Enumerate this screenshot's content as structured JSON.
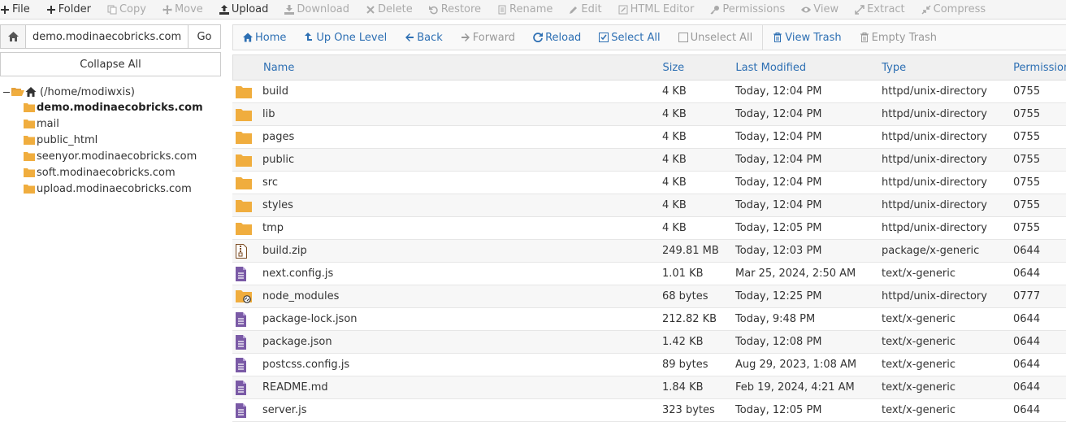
{
  "toolbar": {
    "buttons": [
      {
        "label": "File",
        "icon": "plus-icon",
        "enabled": true
      },
      {
        "label": "Folder",
        "icon": "plus-icon",
        "enabled": true
      },
      {
        "label": "Copy",
        "icon": "copy-icon",
        "enabled": false
      },
      {
        "label": "Move",
        "icon": "move-icon",
        "enabled": false
      },
      {
        "label": "Upload",
        "icon": "upload-icon",
        "enabled": true
      },
      {
        "label": "Download",
        "icon": "download-icon",
        "enabled": false
      },
      {
        "label": "Delete",
        "icon": "delete-icon",
        "enabled": false
      },
      {
        "label": "Restore",
        "icon": "restore-icon",
        "enabled": false
      },
      {
        "label": "Rename",
        "icon": "rename-icon",
        "enabled": false
      },
      {
        "label": "Edit",
        "icon": "pencil-icon",
        "enabled": false
      },
      {
        "label": "HTML Editor",
        "icon": "html-editor-icon",
        "enabled": false
      },
      {
        "label": "Permissions",
        "icon": "key-icon",
        "enabled": false
      },
      {
        "label": "View",
        "icon": "eye-icon",
        "enabled": false
      },
      {
        "label": "Extract",
        "icon": "extract-icon",
        "enabled": false
      },
      {
        "label": "Compress",
        "icon": "compress-icon",
        "enabled": false
      }
    ]
  },
  "sidebar": {
    "address_value": "demo.modinaecobricks.com",
    "go_label": "Go",
    "collapse_label": "Collapse All",
    "root_label": "(/home/modiwxis)",
    "items": [
      {
        "label": "demo.modinaecobricks.com",
        "active": true
      },
      {
        "label": "mail",
        "active": false
      },
      {
        "label": "public_html",
        "active": false
      },
      {
        "label": "seenyor.modinaecobricks.com",
        "active": false
      },
      {
        "label": "soft.modinaecobricks.com",
        "active": false
      },
      {
        "label": "upload.modinaecobricks.com",
        "active": false
      }
    ]
  },
  "navbar": {
    "buttons": [
      {
        "label": "Home",
        "icon": "home-icon",
        "enabled": true
      },
      {
        "label": "Up One Level",
        "icon": "up-level-icon",
        "enabled": true
      },
      {
        "label": "Back",
        "icon": "arrow-left-icon",
        "enabled": true
      },
      {
        "label": "Forward",
        "icon": "arrow-right-icon",
        "enabled": false
      },
      {
        "label": "Reload",
        "icon": "reload-icon",
        "enabled": true
      },
      {
        "label": "Select All",
        "icon": "checkbox-checked-icon",
        "enabled": true
      },
      {
        "label": "Unselect All",
        "icon": "checkbox-empty-icon",
        "enabled": false
      },
      {
        "label": "View Trash",
        "icon": "trash-icon",
        "enabled": true
      },
      {
        "label": "Empty Trash",
        "icon": "trash-icon",
        "enabled": false
      }
    ]
  },
  "table": {
    "headers": {
      "name": "Name",
      "size": "Size",
      "modified": "Last Modified",
      "type": "Type",
      "permissions": "Permissions"
    },
    "rows": [
      {
        "icon": "folder-icon",
        "name": "build",
        "size": "4 KB",
        "modified": "Today, 12:04 PM",
        "type": "httpd/unix-directory",
        "perm": "0755"
      },
      {
        "icon": "folder-icon",
        "name": "lib",
        "size": "4 KB",
        "modified": "Today, 12:04 PM",
        "type": "httpd/unix-directory",
        "perm": "0755"
      },
      {
        "icon": "folder-icon",
        "name": "pages",
        "size": "4 KB",
        "modified": "Today, 12:04 PM",
        "type": "httpd/unix-directory",
        "perm": "0755"
      },
      {
        "icon": "folder-icon",
        "name": "public",
        "size": "4 KB",
        "modified": "Today, 12:04 PM",
        "type": "httpd/unix-directory",
        "perm": "0755"
      },
      {
        "icon": "folder-icon",
        "name": "src",
        "size": "4 KB",
        "modified": "Today, 12:04 PM",
        "type": "httpd/unix-directory",
        "perm": "0755"
      },
      {
        "icon": "folder-icon",
        "name": "styles",
        "size": "4 KB",
        "modified": "Today, 12:04 PM",
        "type": "httpd/unix-directory",
        "perm": "0755"
      },
      {
        "icon": "folder-icon",
        "name": "tmp",
        "size": "4 KB",
        "modified": "Today, 12:05 PM",
        "type": "httpd/unix-directory",
        "perm": "0755"
      },
      {
        "icon": "zip-icon",
        "name": "build.zip",
        "size": "249.81 MB",
        "modified": "Today, 12:03 PM",
        "type": "package/x-generic",
        "perm": "0644"
      },
      {
        "icon": "text-file-icon",
        "name": "next.config.js",
        "size": "1.01 KB",
        "modified": "Mar 25, 2024, 2:50 AM",
        "type": "text/x-generic",
        "perm": "0644"
      },
      {
        "icon": "folder-link-icon",
        "name": "node_modules",
        "size": "68 bytes",
        "modified": "Today, 12:25 PM",
        "type": "httpd/unix-directory",
        "perm": "0777"
      },
      {
        "icon": "text-file-icon",
        "name": "package-lock.json",
        "size": "212.82 KB",
        "modified": "Today, 9:48 PM",
        "type": "text/x-generic",
        "perm": "0644"
      },
      {
        "icon": "text-file-icon",
        "name": "package.json",
        "size": "1.42 KB",
        "modified": "Today, 12:08 PM",
        "type": "text/x-generic",
        "perm": "0644"
      },
      {
        "icon": "text-file-icon",
        "name": "postcss.config.js",
        "size": "89 bytes",
        "modified": "Aug 29, 2023, 1:08 AM",
        "type": "text/x-generic",
        "perm": "0644"
      },
      {
        "icon": "text-file-icon",
        "name": "README.md",
        "size": "1.84 KB",
        "modified": "Feb 19, 2024, 4:21 AM",
        "type": "text/x-generic",
        "perm": "0644"
      },
      {
        "icon": "text-file-icon",
        "name": "server.js",
        "size": "323 bytes",
        "modified": "Today, 12:05 PM",
        "type": "text/x-generic",
        "perm": "0644"
      }
    ]
  },
  "colors": {
    "link": "#2d6fb3",
    "folder": "#f0ad3e",
    "text_file": "#7a5aa6"
  }
}
